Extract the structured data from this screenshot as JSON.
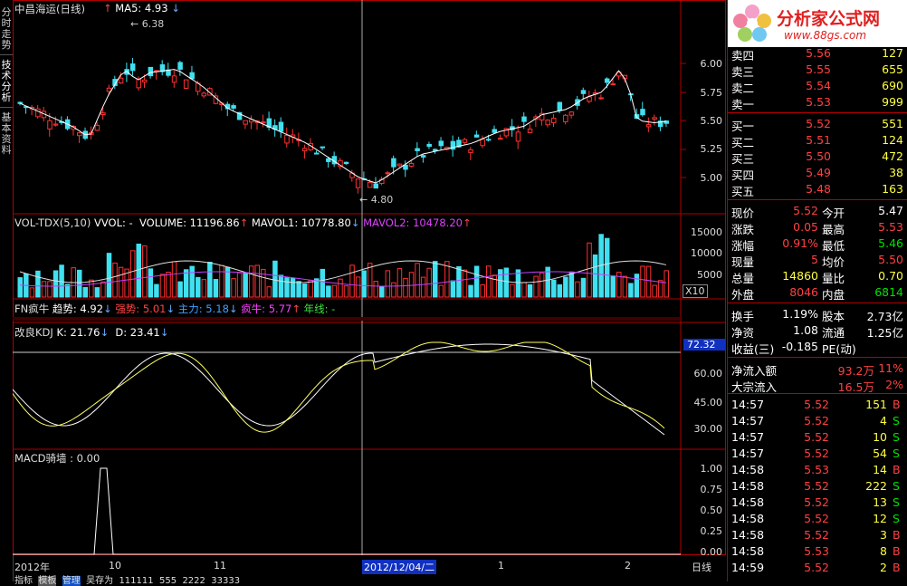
{
  "left_tabs": [
    "分时走势",
    "技术分析",
    "基本资料"
  ],
  "header": {
    "title": "中昌海运(日线)",
    "ma": "MA5: 4.93",
    "high_marker": "6.38",
    "low_marker": "4.80"
  },
  "price_axis": [
    "6.00",
    "5.75",
    "5.50",
    "5.25",
    "5.00"
  ],
  "vol": {
    "name": "VOL-TDX(5,10)",
    "vvol": "VVOL: -",
    "volume": "VOLUME: 11196.86",
    "mavol1": "MAVOL1: 10778.80",
    "mavol2": "MAVOL2: 10478.20",
    "axis": [
      "15000",
      "10000",
      "5000"
    ],
    "unit": "X10"
  },
  "fn": {
    "name": "FN疯牛",
    "trend": "趋势: 4.92",
    "strong": "强势: 5.01",
    "main": "主力: 5.18",
    "bull": "疯牛: 5.77",
    "year": "年线: -"
  },
  "kdj": {
    "name": "改良KDJ",
    "k": "K: 21.76",
    "d": "D: 23.41",
    "axis": [
      "60.00",
      "45.00",
      "30.00"
    ],
    "badge": "72.32"
  },
  "macd": {
    "name": "MACD骑墙 : 0.00",
    "axis": [
      "1.00",
      "0.75",
      "0.50",
      "0.25",
      "0.00"
    ]
  },
  "timeline": {
    "labels": [
      "2012年",
      "10",
      "11",
      "12",
      "1",
      "2"
    ],
    "cursor": "2012/12/04/二",
    "period": "日线"
  },
  "bottom_tabs": [
    "指标",
    "模板",
    "管理",
    "吴存为",
    "111111",
    "555",
    "2222",
    "33333"
  ],
  "logo": {
    "text": "分析家公式网",
    "url": "www.88gs.com"
  },
  "orderbook": {
    "asks": [
      {
        "label": "卖四",
        "price": "5.56",
        "vol": "127"
      },
      {
        "label": "卖三",
        "price": "5.55",
        "vol": "655"
      },
      {
        "label": "卖二",
        "price": "5.54",
        "vol": "690"
      },
      {
        "label": "卖一",
        "price": "5.53",
        "vol": "999"
      }
    ],
    "bids": [
      {
        "label": "买一",
        "price": "5.52",
        "vol": "551"
      },
      {
        "label": "买二",
        "price": "5.51",
        "vol": "124"
      },
      {
        "label": "买三",
        "price": "5.50",
        "vol": "472"
      },
      {
        "label": "买四",
        "price": "5.49",
        "vol": "38"
      },
      {
        "label": "买五",
        "price": "5.48",
        "vol": "163"
      }
    ]
  },
  "quote": [
    {
      "l1": "现价",
      "v1": "5.52",
      "l2": "今开",
      "v2": "5.47"
    },
    {
      "l1": "涨跌",
      "v1": "0.05",
      "l2": "最高",
      "v2": "5.53"
    },
    {
      "l1": "涨幅",
      "v1": "0.91%",
      "l2": "最低",
      "v2": "5.46"
    },
    {
      "l1": "现量",
      "v1": "5",
      "l2": "均价",
      "v2": "5.50"
    },
    {
      "l1": "总量",
      "v1": "14860",
      "l2": "量比",
      "v2": "0.70"
    },
    {
      "l1": "外盘",
      "v1": "8046",
      "l2": "内盘",
      "v2": "6814"
    }
  ],
  "stats": [
    {
      "l1": "换手",
      "v1": "1.19%",
      "l2": "股本",
      "v2": "2.73亿"
    },
    {
      "l1": "净资",
      "v1": "1.08",
      "l2": "流通",
      "v2": "1.25亿"
    },
    {
      "l1": "收益(三)",
      "v1": "-0.185",
      "l2": "PE(动)",
      "v2": ""
    }
  ],
  "flow": [
    {
      "label": "净流入额",
      "value": "93.2万",
      "pct": "11%"
    },
    {
      "label": "大宗流入",
      "value": "16.5万",
      "pct": "2%"
    }
  ],
  "ticks": [
    {
      "time": "14:57",
      "price": "5.52",
      "vol": "151",
      "side": "B"
    },
    {
      "time": "14:57",
      "price": "5.52",
      "vol": "4",
      "side": "S"
    },
    {
      "time": "14:57",
      "price": "5.52",
      "vol": "10",
      "side": "S"
    },
    {
      "time": "14:57",
      "price": "5.52",
      "vol": "54",
      "side": "S"
    },
    {
      "time": "14:58",
      "price": "5.53",
      "vol": "14",
      "side": "B"
    },
    {
      "time": "14:58",
      "price": "5.52",
      "vol": "222",
      "side": "S"
    },
    {
      "time": "14:58",
      "price": "5.52",
      "vol": "13",
      "side": "S"
    },
    {
      "time": "14:58",
      "price": "5.52",
      "vol": "12",
      "side": "S"
    },
    {
      "time": "14:58",
      "price": "5.52",
      "vol": "3",
      "side": "B"
    },
    {
      "time": "14:58",
      "price": "5.53",
      "vol": "8",
      "side": "B"
    },
    {
      "time": "14:59",
      "price": "5.52",
      "vol": "2",
      "side": "B"
    }
  ]
}
